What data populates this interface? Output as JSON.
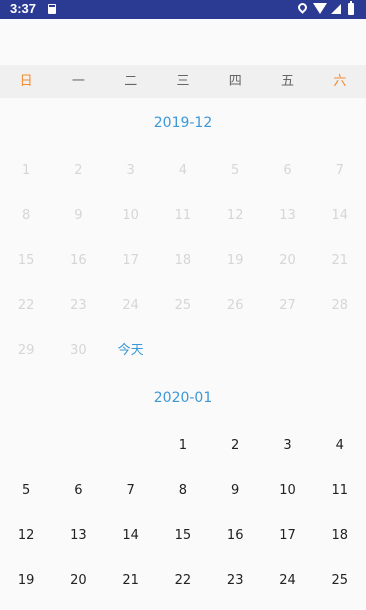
{
  "status_bar": {
    "time": "3:37",
    "icons": [
      "sd-card-icon",
      "location-icon",
      "wifi-icon",
      "signal-icon",
      "battery-icon"
    ]
  },
  "weekdays": [
    "日",
    "一",
    "二",
    "三",
    "四",
    "五",
    "六"
  ],
  "colors": {
    "accent": "#3c98d6",
    "weekend": "#f08a30",
    "status_bar": "#2b3a93"
  },
  "months": [
    {
      "title": "2019-12",
      "days": [
        "1",
        "2",
        "3",
        "4",
        "5",
        "6",
        "7",
        "8",
        "9",
        "10",
        "11",
        "12",
        "13",
        "14",
        "15",
        "16",
        "17",
        "18",
        "19",
        "20",
        "21",
        "22",
        "23",
        "24",
        "25",
        "26",
        "27",
        "28",
        "29",
        "30",
        "今天"
      ]
    },
    {
      "title": "2020-01",
      "days": [
        "",
        "",
        "",
        "1",
        "2",
        "3",
        "4",
        "5",
        "6",
        "7",
        "8",
        "9",
        "10",
        "11",
        "12",
        "13",
        "14",
        "15",
        "16",
        "17",
        "18",
        "19",
        "20",
        "21",
        "22",
        "23",
        "24",
        "25"
      ]
    }
  ]
}
